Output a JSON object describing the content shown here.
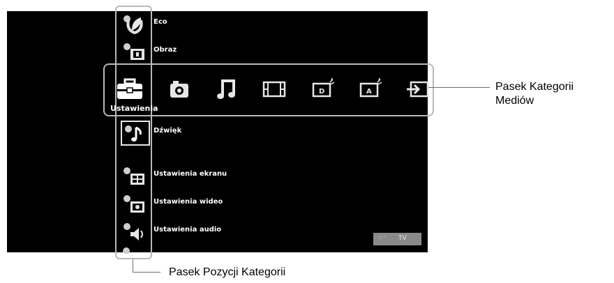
{
  "menu": {
    "items": [
      {
        "label": "Eco",
        "icon": "eco-leaf-icon"
      },
      {
        "label": "Obraz",
        "icon": "picture-icon"
      },
      {
        "label": "Dźwięk",
        "icon": "sound-note-icon"
      },
      {
        "label": "Ustawienia ekranu",
        "icon": "screen-settings-icon"
      },
      {
        "label": "Ustawienia wideo",
        "icon": "video-settings-icon"
      },
      {
        "label": "Ustawienia audio",
        "icon": "audio-settings-icon"
      }
    ],
    "selected_category": "Ustawienia"
  },
  "media_bar": {
    "icons": [
      "toolbox-icon",
      "camera-icon",
      "music-icon",
      "film-icon",
      "digital-tv-icon",
      "analog-tv-icon",
      "input-icon"
    ]
  },
  "status": {
    "source": "TV",
    "hint": "·:··"
  },
  "callouts": {
    "media_bar_line1": "Pasek Kategorii",
    "media_bar_line2": "Mediów",
    "items_bar": "Pasek Pozycji Kategorii"
  }
}
